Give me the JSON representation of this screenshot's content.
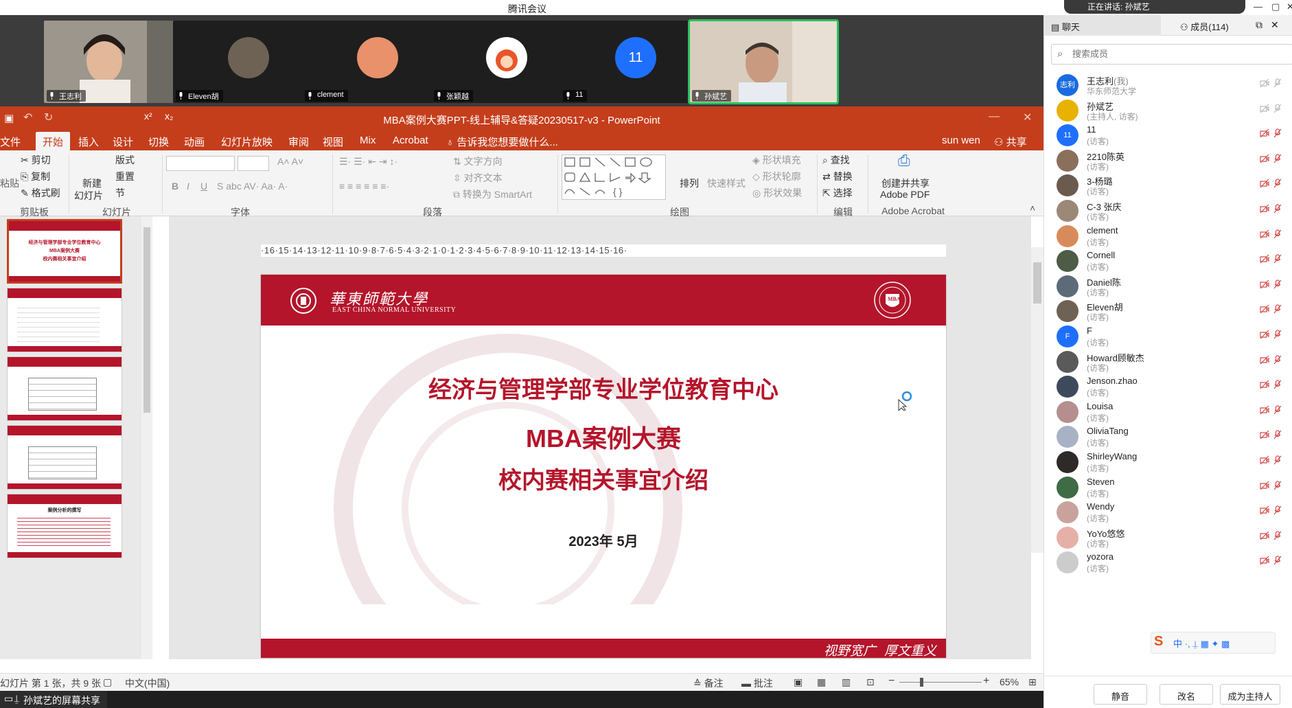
{
  "app": {
    "title": "腾讯会议",
    "speaking_label": "正在讲话: 孙斌艺"
  },
  "participants_strip": [
    {
      "name": "王志利"
    },
    {
      "name": "Eleven胡"
    },
    {
      "name": "clement"
    },
    {
      "name": "张颖越"
    },
    {
      "name": "11",
      "avatar_text": "11"
    },
    {
      "name": "孙斌艺"
    }
  ],
  "ppt": {
    "window_title": "MBA案例大赛PPT-线上辅导&答疑20230517-v3 - PowerPoint",
    "menu": [
      "文件",
      "开始",
      "插入",
      "设计",
      "切换",
      "动画",
      "幻灯片放映",
      "审阅",
      "视图",
      "Mix",
      "Acrobat"
    ],
    "tell_me": "告诉我您想要做什么...",
    "user": "sun wen",
    "share": "共享",
    "ribbon": {
      "paste": "粘贴",
      "cut": "剪切",
      "copy": "复制",
      "format_painter": "格式刷",
      "clipboard": "剪贴板",
      "new_slide": "新建",
      "new_slide2": "幻灯片",
      "layout": "版式",
      "reset": "重置",
      "section": "节",
      "slides": "幻灯片",
      "font": "字体",
      "paragraph": "段落",
      "text_direction": "文字方向",
      "align_text": "对齐文本",
      "smartart": "转换为 SmartArt",
      "arrange": "排列",
      "quick_styles": "快速样式",
      "shape_fill": "形状填充",
      "shape_outline": "形状轮廓",
      "shape_effects": "形状效果",
      "drawing": "绘图",
      "find": "查找",
      "replace": "替换",
      "select": "选择",
      "editing": "编辑",
      "create_pdf1": "创建并共享",
      "create_pdf2": "Adobe PDF",
      "adobe": "Adobe Acrobat"
    },
    "ruler_h": "·16·15·14·13·12·11·10·9·8·7·6·5·4·3·2·1·0·1·2·3·4·5·6·7·8·9·10·11·12·13·14·15·16·",
    "slide": {
      "university_cn": "華東師範大學",
      "university_en": "EAST CHINA NORMAL UNIVERSITY",
      "line1": "经济与管理学部专业学位教育中心",
      "line2": "MBA案例大赛",
      "line3": "校内赛相关事宜介绍",
      "date": "2023年 5月",
      "motto": "视野宽广  厚文重义"
    },
    "thumbnails": [
      {
        "t1": "经济与管理学部专业学位教育中心",
        "t2": "MBA案例大赛",
        "t3": "校内赛相关事宜介绍"
      },
      {
        "t1": "",
        "t2": "",
        "t3": ""
      },
      {
        "t1": "",
        "t2": "",
        "t3": ""
      },
      {
        "t1": "",
        "t2": "",
        "t3": ""
      },
      {
        "t1": "案例分析的撰写",
        "t2": "",
        "t3": ""
      }
    ],
    "status": {
      "slide_of": "幻灯片 第 1 张，共 9 张",
      "language": "中文(中国)",
      "notes": "备注",
      "comments": "批注",
      "zoom": "65%"
    }
  },
  "sharebar": "孙斌艺的屏幕共享",
  "panel": {
    "tab_chat": "聊天",
    "tab_members": "成员(114)",
    "search_placeholder": "搜索成员",
    "members": [
      {
        "name": "王志利",
        "suffix": "(我)",
        "role": "华东师范大学",
        "avatar": "志利",
        "color": "#1a6be0"
      },
      {
        "name": "孙斌艺",
        "suffix": "",
        "role": "(主持人, 访客)",
        "avatar": "",
        "color": "#e9b100"
      },
      {
        "name": "11",
        "suffix": "",
        "role": "(访客)",
        "avatar": "11",
        "color": "#1f6fff"
      },
      {
        "name": "2210陈英",
        "suffix": "",
        "role": "(访客)",
        "avatar": "",
        "color": "#8a6f5c"
      },
      {
        "name": "3-杨璐",
        "suffix": "",
        "role": "(访客)",
        "avatar": "",
        "color": "#6b5a4e"
      },
      {
        "name": "C-3 张庆",
        "suffix": "",
        "role": "(访客)",
        "avatar": "",
        "color": "#9b8877"
      },
      {
        "name": "clement",
        "suffix": "",
        "role": "(访客)",
        "avatar": "",
        "color": "#d98a5a"
      },
      {
        "name": "Cornell",
        "suffix": "",
        "role": "(访客)",
        "avatar": "",
        "color": "#4e5b46"
      },
      {
        "name": "Daniel陈",
        "suffix": "",
        "role": "(访客)",
        "avatar": "",
        "color": "#5d6b78"
      },
      {
        "name": "Eleven胡",
        "suffix": "",
        "role": "(访客)",
        "avatar": "",
        "color": "#6e6254"
      },
      {
        "name": "F",
        "suffix": "",
        "role": "(访客)",
        "avatar": "F",
        "color": "#1f6fff"
      },
      {
        "name": "Howard顾敏杰",
        "suffix": "",
        "role": "(访客)",
        "avatar": "",
        "color": "#5a5a5a"
      },
      {
        "name": "Jenson.zhao",
        "suffix": "",
        "role": "(访客)",
        "avatar": "",
        "color": "#3d4a5c"
      },
      {
        "name": "Louisa",
        "suffix": "",
        "role": "(访客)",
        "avatar": "",
        "color": "#b58f8f"
      },
      {
        "name": "OliviaTang",
        "suffix": "",
        "role": "(访客)",
        "avatar": "",
        "color": "#a8b2c4"
      },
      {
        "name": "ShirleyWang",
        "suffix": "",
        "role": "(访客)",
        "avatar": "",
        "color": "#2e2a28"
      },
      {
        "name": "Steven",
        "suffix": "",
        "role": "(访客)",
        "avatar": "",
        "color": "#3f6b45"
      },
      {
        "name": "Wendy",
        "suffix": "",
        "role": "(访客)",
        "avatar": "",
        "color": "#c9a39b"
      },
      {
        "name": "YoYo悠悠",
        "suffix": "",
        "role": "(访客)",
        "avatar": "",
        "color": "#e6b0a8"
      },
      {
        "name": "yozora",
        "suffix": "",
        "role": "(访客)",
        "avatar": "",
        "color": "#cccccc"
      }
    ],
    "btn_mute": "静音",
    "btn_rename": "改名",
    "btn_host": "成为主持人"
  }
}
